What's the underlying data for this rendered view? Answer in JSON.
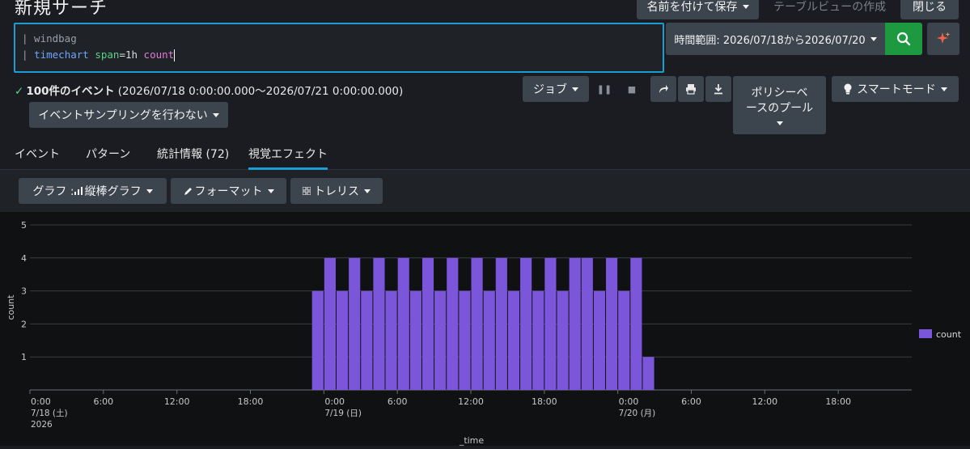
{
  "header": {
    "title": "新規サーチ",
    "save_as_label": "名前を付けて保存",
    "table_view_label": "テーブルビューの作成",
    "close_label": "閉じる"
  },
  "search": {
    "line1": "| windbag",
    "line2_pipe": "| ",
    "line2_cmd": "timechart",
    "line2_arg_key": "span",
    "line2_arg_eq": "=1h ",
    "line2_func": "count"
  },
  "time_range": {
    "label": "時間範囲: 2026/07/18から2026/07/20"
  },
  "status": {
    "count_label": "100件のイベント",
    "range_text": " (2026/07/18 0:00:00.000～2026/07/21 0:00:00.000)"
  },
  "toolbar": {
    "job_label": "ジョブ",
    "policy_label_1": "ポリシーベ",
    "policy_label_2": "ースのプール",
    "smart_mode_label": "スマートモード",
    "sampling_label": "イベントサンプリングを行わない"
  },
  "tabs": [
    {
      "label": "イベント"
    },
    {
      "label": "パターン"
    },
    {
      "label": "統計情報 (72)"
    },
    {
      "label": "視覚エフェクト"
    }
  ],
  "viz_toolbar": {
    "graph_label": "グラフ : ",
    "graph_type": "縦棒グラフ",
    "format_label": "フォーマット",
    "trellis_label": "トレリス"
  },
  "colors": {
    "accent": "#1a9cd4",
    "bar": "#7b56db",
    "go": "#1d9a3f"
  },
  "chart_data": {
    "type": "bar",
    "ylabel": "count",
    "xlabel": "_time",
    "ylim": [
      0,
      5
    ],
    "yticks": [
      "1",
      "2",
      "3",
      "4",
      "5"
    ],
    "xticks": [
      {
        "label": "0:00",
        "sub1": "7/18 (土)",
        "sub2": "2026",
        "hour": 0
      },
      {
        "label": "6:00",
        "sub1": "",
        "sub2": "",
        "hour": 6
      },
      {
        "label": "12:00",
        "sub1": "",
        "sub2": "",
        "hour": 12
      },
      {
        "label": "18:00",
        "sub1": "",
        "sub2": "",
        "hour": 18
      },
      {
        "label": "0:00",
        "sub1": "7/19 (日)",
        "sub2": "",
        "hour": 24
      },
      {
        "label": "6:00",
        "sub1": "",
        "sub2": "",
        "hour": 30
      },
      {
        "label": "12:00",
        "sub1": "",
        "sub2": "",
        "hour": 36
      },
      {
        "label": "18:00",
        "sub1": "",
        "sub2": "",
        "hour": 42
      },
      {
        "label": "0:00",
        "sub1": "7/20 (月)",
        "sub2": "",
        "hour": 48
      },
      {
        "label": "6:00",
        "sub1": "",
        "sub2": "",
        "hour": 54
      },
      {
        "label": "12:00",
        "sub1": "",
        "sub2": "",
        "hour": 60
      },
      {
        "label": "18:00",
        "sub1": "",
        "sub2": "",
        "hour": 66
      }
    ],
    "series": [
      {
        "name": "count",
        "start_hour": 23,
        "values": [
          3,
          4,
          3,
          4,
          3,
          4,
          3,
          4,
          3,
          4,
          3,
          4,
          3,
          4,
          3,
          4,
          3,
          4,
          3,
          4,
          3,
          4,
          4,
          3,
          4,
          3,
          4,
          1
        ]
      }
    ],
    "legend": "right"
  }
}
